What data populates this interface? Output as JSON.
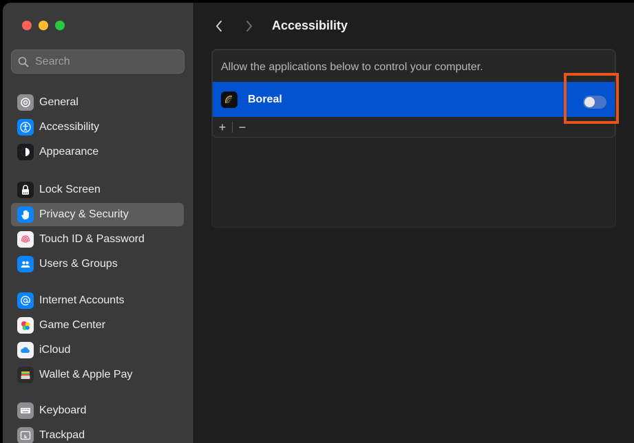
{
  "window": {
    "traffic_lights": {
      "close": "#fe5f57",
      "minimize": "#febc2e",
      "zoom": "#28c840"
    }
  },
  "sidebar": {
    "search_placeholder": "Search",
    "items": [
      {
        "label": "General",
        "icon": "gear-icon",
        "color": "#8e8e93"
      },
      {
        "label": "Accessibility",
        "icon": "accessibility-icon",
        "color": "#0a84ff"
      },
      {
        "label": "Appearance",
        "icon": "appearance-icon",
        "color": "#1c1c1e"
      },
      {
        "label": "Lock Screen",
        "icon": "lock-icon",
        "color": "#1c1c1e"
      },
      {
        "label": "Privacy & Security",
        "icon": "hand-icon",
        "color": "#0a84ff",
        "selected": true
      },
      {
        "label": "Touch ID & Password",
        "icon": "fingerprint-icon",
        "color": "#f2f2f7"
      },
      {
        "label": "Users & Groups",
        "icon": "users-icon",
        "color": "#0a84ff"
      },
      {
        "label": "Internet Accounts",
        "icon": "at-icon",
        "color": "#0a84ff"
      },
      {
        "label": "Game Center",
        "icon": "game-center-icon",
        "color": "#f2f2f7"
      },
      {
        "label": "iCloud",
        "icon": "cloud-icon",
        "color": "#f2f2f7"
      },
      {
        "label": "Wallet & Apple Pay",
        "icon": "wallet-icon",
        "color": "#2c2c2e"
      },
      {
        "label": "Keyboard",
        "icon": "keyboard-icon",
        "color": "#8e8e93"
      },
      {
        "label": "Trackpad",
        "icon": "trackpad-icon",
        "color": "#8e8e93"
      }
    ]
  },
  "toolbar": {
    "title": "Accessibility",
    "back_icon": "chevron-left-icon",
    "forward_icon": "chevron-right-icon"
  },
  "main": {
    "description": "Allow the applications below to control your computer.",
    "apps": [
      {
        "name": "Boreal",
        "icon": "boreal-app-icon",
        "enabled": false
      }
    ],
    "add_label": "+",
    "remove_label": "−"
  },
  "colors": {
    "accent": "#0052d1",
    "highlight": "#e9531c"
  }
}
